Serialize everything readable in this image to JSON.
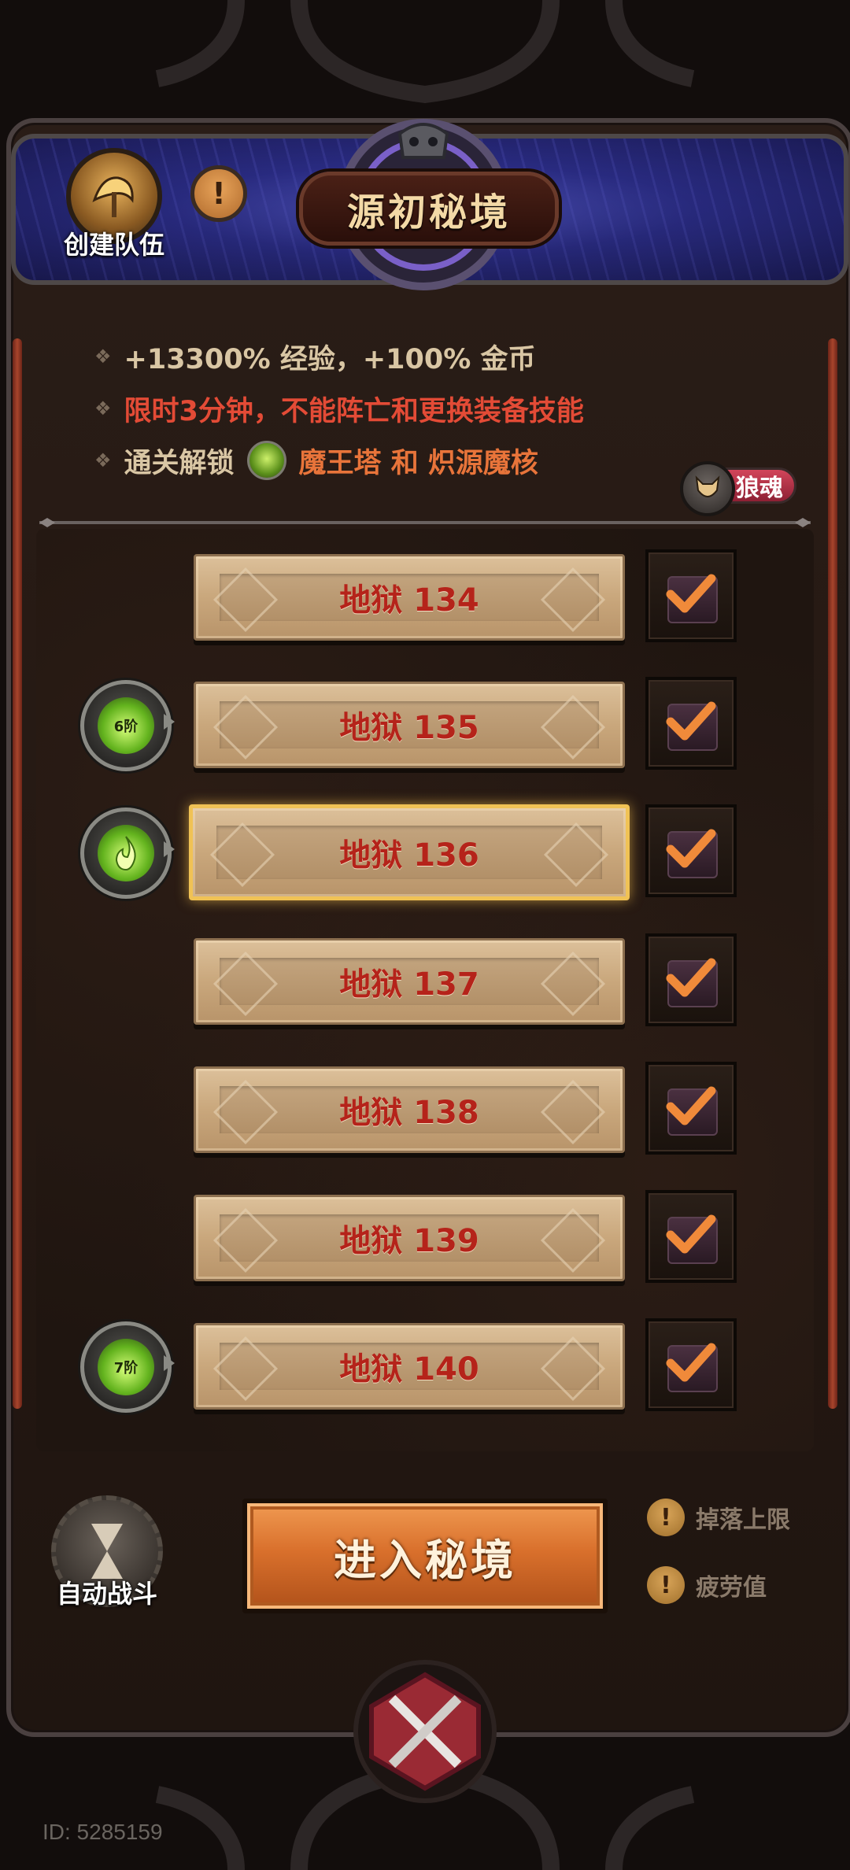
{
  "header": {
    "title": "源初秘境",
    "create_team_label": "创建队伍",
    "info_icon": "exclamation-icon"
  },
  "info": {
    "line1": "+13300% 经验，+100% 金币",
    "line2": "限时3分钟，不能阵亡和更换装备技能",
    "line3_prefix": "通关解锁",
    "line3_unlock": "魔王塔 和 炽源魔核"
  },
  "wolf_tag": {
    "label": "狼魂"
  },
  "levels": [
    {
      "label": "地狱 134",
      "badge": "",
      "selected": false,
      "checked": true
    },
    {
      "label": "地狱 135",
      "badge": "6阶",
      "selected": false,
      "checked": true
    },
    {
      "label": "地狱 136",
      "badge": "flame",
      "selected": true,
      "checked": true
    },
    {
      "label": "地狱 137",
      "badge": "",
      "selected": false,
      "checked": true
    },
    {
      "label": "地狱 138",
      "badge": "",
      "selected": false,
      "checked": true
    },
    {
      "label": "地狱 139",
      "badge": "",
      "selected": false,
      "checked": true
    },
    {
      "label": "地狱 140",
      "badge": "7阶",
      "selected": false,
      "checked": true
    }
  ],
  "bottom": {
    "auto_battle_label": "自动战斗",
    "enter_label": "进入秘境",
    "hint1": "掉落上限",
    "hint2": "疲劳值"
  },
  "footer": {
    "id_text": "ID: 5285159"
  },
  "colors": {
    "accent_orange": "#d9702c",
    "text_red": "#e34b36",
    "level_text": "#b5231a",
    "selected_border": "#f0c255",
    "check_orange": "#f08a3a"
  }
}
